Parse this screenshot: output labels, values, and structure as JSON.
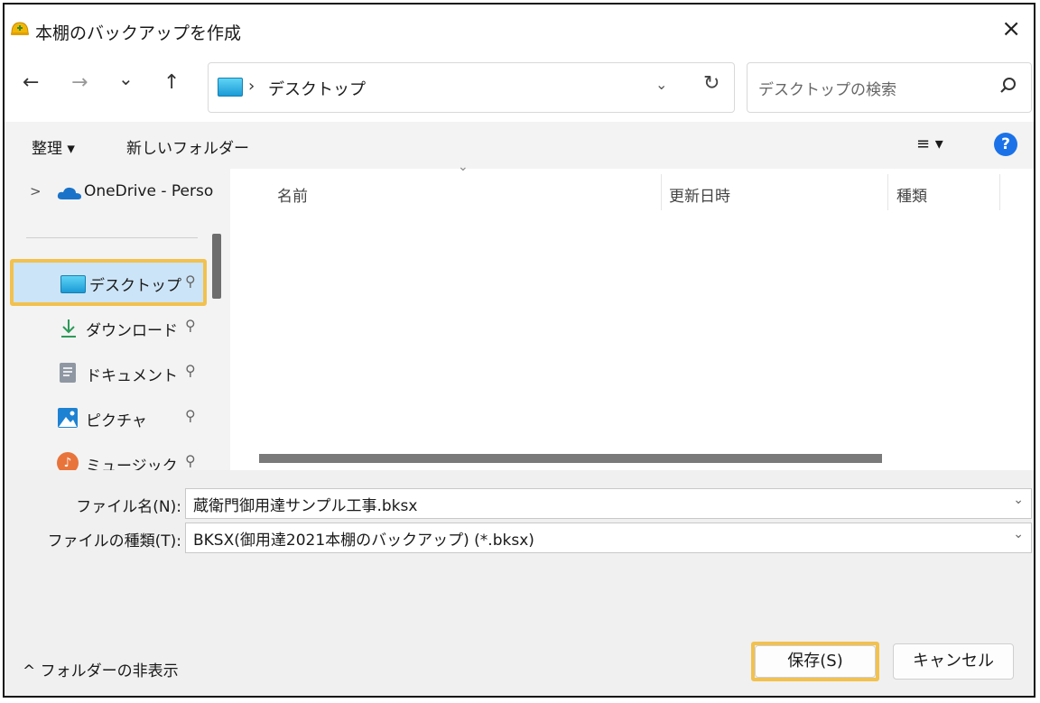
{
  "window": {
    "title": "本棚のバックアップを作成",
    "close_glyph": "×"
  },
  "nav": {
    "back_glyph": "←",
    "forward_glyph": "→",
    "recent_glyph": "⌄",
    "up_glyph": "↑",
    "address": {
      "separator": "›",
      "current": "デスクトップ",
      "dropdown_glyph": "⌄",
      "refresh_glyph": "↻"
    },
    "search": {
      "placeholder": "デスクトップの検索"
    }
  },
  "toolbar": {
    "organize_label": "整理 ▾",
    "new_folder_label": "新しいフォルダー",
    "view_glyph": "≡ ▾",
    "help_glyph": "?"
  },
  "sidebar": {
    "items": [
      {
        "label": "OneDrive - Perso",
        "icon": "cloud-icon"
      },
      {
        "label": "デスクトップ",
        "icon": "desktop-folder-icon"
      },
      {
        "label": "ダウンロード",
        "icon": "download-icon"
      },
      {
        "label": "ドキュメント",
        "icon": "document-icon"
      },
      {
        "label": "ピクチャ",
        "icon": "picture-icon"
      },
      {
        "label": "ミュージック",
        "icon": "music-icon"
      }
    ],
    "expand_glyph": ">",
    "pin_glyph": "📌"
  },
  "content": {
    "sort_glyph": "⌄",
    "columns": [
      "名前",
      "更新日時",
      "種類"
    ]
  },
  "form": {
    "filename_label": "ファイル名(N):",
    "filename_value": "蔵衛門御用達サンプル工事.bksx",
    "filetype_label": "ファイルの種類(T):",
    "filetype_value": "BKSX(御用達2021本棚のバックアップ) (*.bksx)",
    "dropdown_glyph": "⌄"
  },
  "footer": {
    "hide_folders_label": "^ フォルダーの非表示",
    "save_label": "保存(S)",
    "cancel_label": "キャンセル"
  },
  "colors": {
    "highlight": "#f2c14e",
    "selected": "#cce4f7",
    "help": "#1b72e8"
  }
}
